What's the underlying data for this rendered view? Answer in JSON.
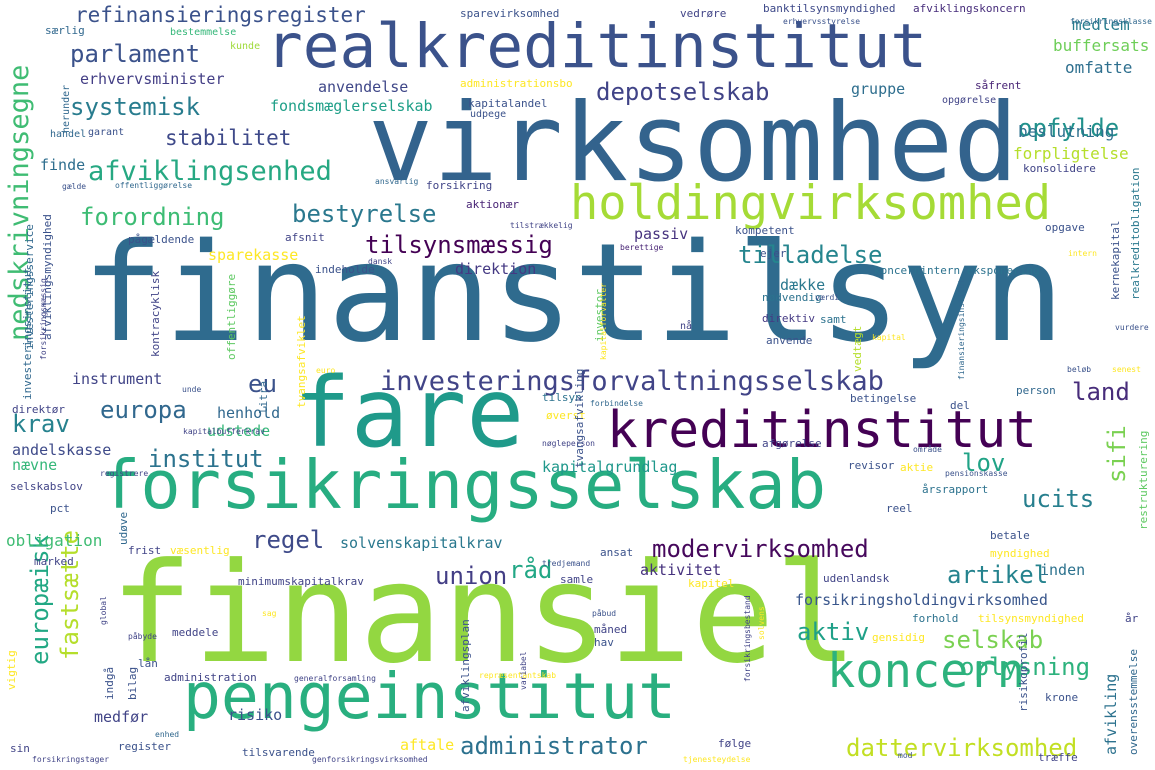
{
  "words": [
    {
      "text": "finanstilsyn",
      "color": "#2f6b8e"
    },
    {
      "text": "finansiel",
      "color": "#93d741"
    },
    {
      "text": "virksomhed",
      "color": "#33638d"
    },
    {
      "text": "fare",
      "color": "#1f9a8a"
    },
    {
      "text": "forsikringsselskab",
      "color": "#27ad81"
    },
    {
      "text": "realkreditinstitut",
      "color": "#3b528b"
    },
    {
      "text": "pengeinstitut",
      "color": "#29af7f"
    },
    {
      "text": "holdingvirksomhed",
      "color": "#a5db36"
    },
    {
      "text": "kreditinstitut",
      "color": "#440154"
    },
    {
      "text": "investeringsforvaltningsselskab",
      "color": "#414487"
    },
    {
      "text": "koncern",
      "color": "#2db27d"
    },
    {
      "text": "nedskrivningsegne",
      "color": "#3fbc73"
    },
    {
      "text": "afviklingsenhed",
      "color": "#26a882"
    },
    {
      "text": "depotselskab",
      "color": "#404387"
    },
    {
      "text": "systemisk",
      "color": "#287c8e"
    },
    {
      "text": "forordning",
      "color": "#3dbc74"
    },
    {
      "text": "bestyrelse",
      "color": "#2a788e"
    },
    {
      "text": "tilsynsmæssig",
      "color": "#440154"
    },
    {
      "text": "tilladelse",
      "color": "#25858e"
    },
    {
      "text": "stabilitet",
      "color": "#3e4989"
    },
    {
      "text": "parlament",
      "color": "#3b528b"
    },
    {
      "text": "refinansieringsregister",
      "color": "#3b528b"
    },
    {
      "text": "opfylde",
      "color": "#21918c"
    },
    {
      "text": "modervirksomhed",
      "color": "#46085c"
    },
    {
      "text": "institut",
      "color": "#2c738e"
    },
    {
      "text": "europa",
      "color": "#31688e"
    },
    {
      "text": "krav",
      "color": "#26828e"
    },
    {
      "text": "eu",
      "color": "#3b528b"
    },
    {
      "text": "lov",
      "color": "#20a386"
    },
    {
      "text": "land",
      "color": "#472c7a"
    },
    {
      "text": "sifi",
      "color": "#7ad151"
    },
    {
      "text": "ucits",
      "color": "#277f8e"
    },
    {
      "text": "regel",
      "color": "#3e4a89"
    },
    {
      "text": "union",
      "color": "#433e85"
    },
    {
      "text": "råd",
      "color": "#22a785"
    },
    {
      "text": "artikel",
      "color": "#25838e"
    },
    {
      "text": "selskab",
      "color": "#7ad151"
    },
    {
      "text": "aktiv",
      "color": "#1fa088"
    },
    {
      "text": "oplysning",
      "color": "#2db27d"
    },
    {
      "text": "europæisk",
      "color": "#22a884"
    },
    {
      "text": "fastsætte",
      "color": "#b5de2b"
    },
    {
      "text": "administrator",
      "color": "#2c718e"
    },
    {
      "text": "dattervirksomhed",
      "color": "#c2df23"
    },
    {
      "text": "erhvervsminister",
      "color": "#433e85"
    },
    {
      "text": "fondsmæglerselskab",
      "color": "#1f9f88"
    },
    {
      "text": "anvendelse",
      "color": "#3f4788"
    },
    {
      "text": "forsikringsholdingvirksomhed",
      "color": "#39568c"
    },
    {
      "text": "solvenskapitalkrav",
      "color": "#2a788e"
    },
    {
      "text": "kapitalgrundlag",
      "color": "#1f988b"
    },
    {
      "text": "obligation",
      "color": "#3fbc73"
    },
    {
      "text": "buffersats",
      "color": "#6ece58"
    },
    {
      "text": "omfatte",
      "color": "#2e6f8e"
    },
    {
      "text": "medlem",
      "color": "#287d8e"
    },
    {
      "text": "beslutning",
      "color": "#2d708e"
    },
    {
      "text": "forpligtelse",
      "color": "#b5de2b"
    },
    {
      "text": "sparekasse",
      "color": "#fde725"
    },
    {
      "text": "instrument",
      "color": "#414487"
    },
    {
      "text": "udstede",
      "color": "#35b779"
    },
    {
      "text": "henhold",
      "color": "#31688e"
    },
    {
      "text": "andelskasse",
      "color": "#3e4a89"
    },
    {
      "text": "direktion",
      "color": "#443983"
    },
    {
      "text": "passiv",
      "color": "#46327e"
    },
    {
      "text": "dække",
      "color": "#2a788e"
    },
    {
      "text": "koncernintern eksponering",
      "color": "#2c728e"
    },
    {
      "text": "kompetent",
      "color": "#3b528b"
    },
    {
      "text": "gruppe",
      "color": "#2e6e8e"
    },
    {
      "text": "aktionær",
      "color": "#482475"
    },
    {
      "text": "finde",
      "color": "#2e6e8e"
    },
    {
      "text": "administrationsbo",
      "color": "#fde725"
    },
    {
      "text": "banktilsynsmyndighed",
      "color": "#3e4989"
    },
    {
      "text": "afviklingskoncern",
      "color": "#472d7b"
    },
    {
      "text": "sparevirksomhed",
      "color": "#3b528b"
    },
    {
      "text": "vedrøre",
      "color": "#414487"
    },
    {
      "text": "erhvervsstyrelse",
      "color": "#3b528b"
    },
    {
      "text": "forsikringsklasse",
      "color": "#31688e"
    },
    {
      "text": "bestemmelse",
      "color": "#35b779"
    },
    {
      "text": "kunde",
      "color": "#9fda3a"
    },
    {
      "text": "særlig",
      "color": "#31688e"
    },
    {
      "text": "kapitalandel",
      "color": "#3b528b"
    },
    {
      "text": "udpege",
      "color": "#3b528b"
    },
    {
      "text": "såfrent",
      "color": "#482475"
    },
    {
      "text": "opgørelse",
      "color": "#414487"
    },
    {
      "text": "herunder",
      "color": "#31688e"
    },
    {
      "text": "handel",
      "color": "#31688e"
    },
    {
      "text": "garant",
      "color": "#3b528b"
    },
    {
      "text": "forsikring",
      "color": "#414487"
    },
    {
      "text": "konsolidere",
      "color": "#414487"
    },
    {
      "text": "afsnit",
      "color": "#414487"
    },
    {
      "text": "pågældende",
      "color": "#3b528b"
    },
    {
      "text": "opgave",
      "color": "#3b528b"
    },
    {
      "text": "tilstrækkelig",
      "color": "#414487"
    },
    {
      "text": "ansvarlig",
      "color": "#31688e"
    },
    {
      "text": "gælde",
      "color": "#3b528b"
    },
    {
      "text": "offentliggørelse",
      "color": "#31688e"
    },
    {
      "text": "kernekapital",
      "color": "#3b528b"
    },
    {
      "text": "realkreditobligation",
      "color": "#2a788e"
    },
    {
      "text": "restrukturering",
      "color": "#5ec962"
    },
    {
      "text": "intern",
      "color": "#fde725"
    },
    {
      "text": "indeholde",
      "color": "#3b528b"
    },
    {
      "text": "dansk",
      "color": "#414487"
    },
    {
      "text": "berettige",
      "color": "#482475"
    },
    {
      "text": "ejer",
      "color": "#3b528b"
    },
    {
      "text": "nødvendig",
      "color": "#2c728e"
    },
    {
      "text": "værdi",
      "color": "#3b528b"
    },
    {
      "text": "nå",
      "color": "#414487"
    },
    {
      "text": "direktiv",
      "color": "#443983"
    },
    {
      "text": "samt",
      "color": "#2c728e"
    },
    {
      "text": "anvende",
      "color": "#3b528b"
    },
    {
      "text": "vedtægt",
      "color": "#b5de2b"
    },
    {
      "text": "kapital",
      "color": "#fde725"
    },
    {
      "text": "vurdere",
      "color": "#3b528b"
    },
    {
      "text": "beløb",
      "color": "#3b528b"
    },
    {
      "text": "senest",
      "color": "#fde725"
    },
    {
      "text": "person",
      "color": "#31688e"
    },
    {
      "text": "kontracyklisk",
      "color": "#414487"
    },
    {
      "text": "offentliggøre",
      "color": "#5ec962"
    },
    {
      "text": "investeringsinstitut",
      "color": "#31688e"
    },
    {
      "text": "investor",
      "color": "#5ec962"
    },
    {
      "text": "kapitalforvalter",
      "color": "#fde725"
    },
    {
      "text": "finansieringsinstitut",
      "color": "#31688e"
    },
    {
      "text": "unde",
      "color": "#3b528b"
    },
    {
      "text": "euro",
      "color": "#fde725"
    },
    {
      "text": "forbindelse",
      "color": "#31688e"
    },
    {
      "text": "betingelse",
      "color": "#3b528b"
    },
    {
      "text": "tilsyn",
      "color": "#2c728e"
    },
    {
      "text": "øverst",
      "color": "#fde725"
    },
    {
      "text": "del",
      "color": "#3b528b"
    },
    {
      "text": "direktør",
      "color": "#414487"
    },
    {
      "text": "kapitalbufferkrav",
      "color": "#414487"
    },
    {
      "text": "nøgleperson",
      "color": "#414487"
    },
    {
      "text": "afgørelse",
      "color": "#414487"
    },
    {
      "text": "område",
      "color": "#3b528b"
    },
    {
      "text": "aktie",
      "color": "#fde725"
    },
    {
      "text": "pensionskasse",
      "color": "#3b528b"
    },
    {
      "text": "nævne",
      "color": "#35b779"
    },
    {
      "text": "registrere",
      "color": "#414487"
    },
    {
      "text": "revisor",
      "color": "#3b528b"
    },
    {
      "text": "årsrapport",
      "color": "#2c728e"
    },
    {
      "text": "selskabslov",
      "color": "#414487"
    },
    {
      "text": "pct",
      "color": "#3b528b"
    },
    {
      "text": "reel",
      "color": "#3b528b"
    },
    {
      "text": "betale",
      "color": "#3b528b"
    },
    {
      "text": "udøve",
      "color": "#31688e"
    },
    {
      "text": "frist",
      "color": "#414487"
    },
    {
      "text": "væsentlig",
      "color": "#fde725"
    },
    {
      "text": "ansat",
      "color": "#3b528b"
    },
    {
      "text": "myndighed",
      "color": "#fde725"
    },
    {
      "text": "marked",
      "color": "#414487"
    },
    {
      "text": "tredjemand",
      "color": "#3b528b"
    },
    {
      "text": "aktivitet",
      "color": "#46327e"
    },
    {
      "text": "samle",
      "color": "#414487"
    },
    {
      "text": "inden",
      "color": "#2c728e"
    },
    {
      "text": "udenlandsk",
      "color": "#414487"
    },
    {
      "text": "minimumskapitalkrav",
      "color": "#414487"
    },
    {
      "text": "kapitel",
      "color": "#fde725"
    },
    {
      "text": "forhold",
      "color": "#2c728e"
    },
    {
      "text": "tilsynsmyndighed",
      "color": "#fde725"
    },
    {
      "text": "år",
      "color": "#414487"
    },
    {
      "text": "sag",
      "color": "#fde725"
    },
    {
      "text": "påbud",
      "color": "#3b528b"
    },
    {
      "text": "meddele",
      "color": "#414487"
    },
    {
      "text": "måned",
      "color": "#414487"
    },
    {
      "text": "hav",
      "color": "#3b528b"
    },
    {
      "text": "gensidig",
      "color": "#fde725"
    },
    {
      "text": "påbyde",
      "color": "#414487"
    },
    {
      "text": "vigtig",
      "color": "#fde725"
    },
    {
      "text": "indgå",
      "color": "#3b528b"
    },
    {
      "text": "lån",
      "color": "#3b528b"
    },
    {
      "text": "bilag",
      "color": "#3b528b"
    },
    {
      "text": "administration",
      "color": "#414487"
    },
    {
      "text": "generalforsamling",
      "color": "#414487"
    },
    {
      "text": "repræsentantskab",
      "color": "#fde725"
    },
    {
      "text": "krone",
      "color": "#3b528b"
    },
    {
      "text": "afvikling",
      "color": "#2c728e"
    },
    {
      "text": "overensstemmelse",
      "color": "#31688e"
    },
    {
      "text": "medfør",
      "color": "#414487"
    },
    {
      "text": "risiko",
      "color": "#3b528b"
    },
    {
      "text": "aftale",
      "color": "#fde725"
    },
    {
      "text": "tilsvarende",
      "color": "#3b528b"
    },
    {
      "text": "følge",
      "color": "#414487"
    },
    {
      "text": "træffe",
      "color": "#414487"
    },
    {
      "text": "mod",
      "color": "#3b528b"
    },
    {
      "text": "sin",
      "color": "#414487"
    },
    {
      "text": "register",
      "color": "#3b528b"
    },
    {
      "text": "forsikringstager",
      "color": "#414487"
    },
    {
      "text": "enhed",
      "color": "#31688e"
    },
    {
      "text": "genforsikringsvirksomhed",
      "color": "#414487"
    },
    {
      "text": "tjenesteydelse",
      "color": "#fde725"
    },
    {
      "text": "investeringsservice",
      "color": "#31688e"
    },
    {
      "text": "afviklingsmyndighed",
      "color": "#3b528b"
    },
    {
      "text": "forsikringsmæssig",
      "color": "#414487"
    },
    {
      "text": "tvangsafviklet",
      "color": "#fde725"
    },
    {
      "text": "litra",
      "color": "#31688e"
    },
    {
      "text": "global",
      "color": "#414487"
    },
    {
      "text": "forsikringsbestand",
      "color": "#414487"
    },
    {
      "text": "solvens",
      "color": "#fde725"
    },
    {
      "text": "variabel",
      "color": "#414487"
    },
    {
      "text": "afviklingsplan",
      "color": "#3b528b"
    },
    {
      "text": "risikoprofil",
      "color": "#3b528b"
    },
    {
      "text": "tvangsafvikling",
      "color": "#3b528b"
    }
  ]
}
